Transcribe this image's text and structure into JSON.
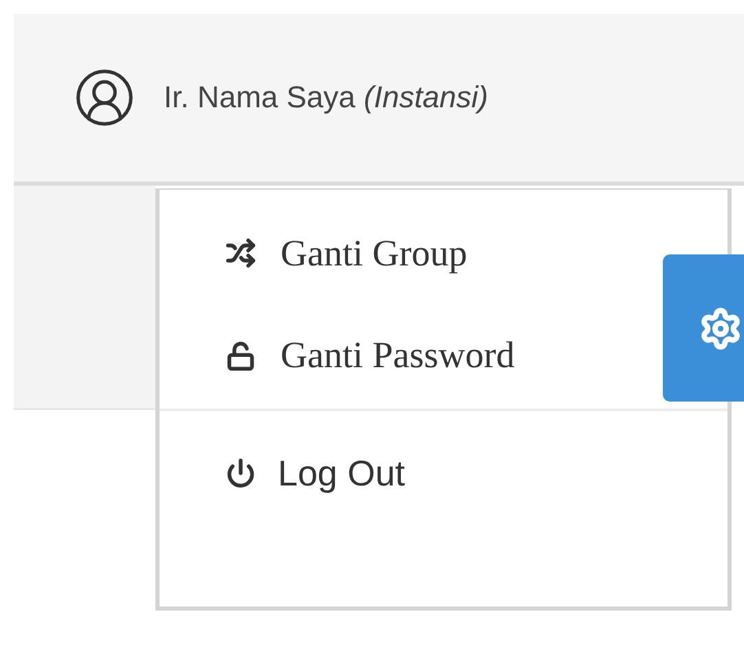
{
  "user": {
    "name": "Ir. Nama Saya *(Instansi)*"
  },
  "menu_groups": [
    {
      "items": [
        {
          "kind": "shuffle",
          "label": "Ganti Group"
        },
        {
          "kind": "unlock",
          "label": "Ganti Password"
        }
      ]
    },
    {
      "items": [
        {
          "kind": "power",
          "label": "Log Out"
        }
      ]
    }
  ]
}
